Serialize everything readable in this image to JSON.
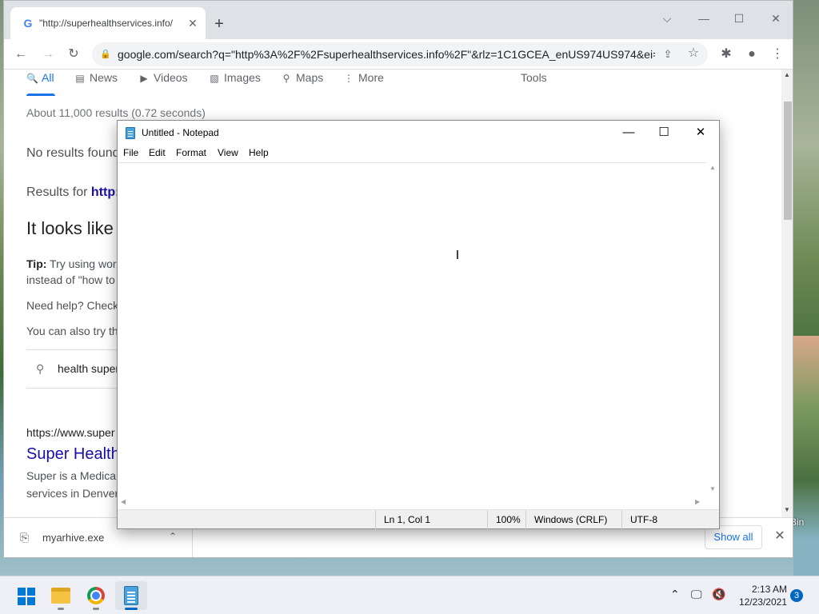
{
  "desktop": {
    "recycle_bin_partial": "Bin"
  },
  "chrome": {
    "tab": {
      "favicon": "G",
      "title": "\"http://superhealthservices.info/",
      "close": "✕"
    },
    "new_tab": "+",
    "window_controls": {
      "dropdown": "⌵",
      "minimize": "—",
      "maximize": "☐",
      "close": "✕"
    },
    "nav": {
      "back": "←",
      "forward": "→",
      "reload": "↻"
    },
    "omnibox": {
      "lock": "🔒",
      "url": "google.com/search?q=\"http%3A%2F%2Fsuperhealthservices.info%2F\"&rlz=1C1GCEA_enUS974US974&ei=...",
      "share": "⇪",
      "star": "☆"
    },
    "extensions": "✱",
    "profile": "●",
    "menu": "⋮"
  },
  "google": {
    "tabs": [
      {
        "label": "All",
        "icon": "search-icon",
        "glyph": "🔍"
      },
      {
        "label": "News",
        "icon": "news-icon",
        "glyph": "▤"
      },
      {
        "label": "Videos",
        "icon": "video-icon",
        "glyph": "▶"
      },
      {
        "label": "Images",
        "icon": "image-icon",
        "glyph": "▧"
      },
      {
        "label": "Maps",
        "icon": "map-pin-icon",
        "glyph": "⚲"
      },
      {
        "label": "More",
        "icon": "more-icon",
        "glyph": "⋮"
      }
    ],
    "tools": "Tools",
    "result_stats": "About 11,000 results (0.72 seconds)",
    "no_results": "No results found",
    "results_for_prefix": "Results for ",
    "results_for_link": "http:",
    "heading": "It looks like",
    "tip_label": "Tip:",
    "tip_text": " Try using word",
    "tip_line2": "instead of \"how to",
    "need_help": "Need help? Check",
    "also_try": "You can also try th",
    "suggestion": "health super",
    "result": {
      "url": "https://www.super",
      "title": "Super Health",
      "snippet1": "Super is a Medicar",
      "snippet2": "services in Denver"
    }
  },
  "downloads": {
    "file_name": "myarhive.exe",
    "show_all": "Show all",
    "close": "✕"
  },
  "notepad": {
    "title": "Untitled - Notepad",
    "controls": {
      "minimize": "—",
      "maximize": "☐",
      "close": "✕"
    },
    "menus": [
      "File",
      "Edit",
      "Format",
      "View",
      "Help"
    ],
    "content": "",
    "status": {
      "position": "Ln 1, Col 1",
      "zoom": "100%",
      "line_endings": "Windows (CRLF)",
      "encoding": "UTF-8"
    }
  },
  "taskbar": {
    "apps": [
      {
        "name": "start",
        "icon": "windows-start-icon"
      },
      {
        "name": "file-explorer",
        "icon": "folder-icon"
      },
      {
        "name": "chrome",
        "icon": "chrome-icon"
      },
      {
        "name": "notepad",
        "icon": "notepad-icon",
        "active": true
      }
    ],
    "tray": {
      "chevron": "⌃",
      "network": "🖵",
      "volume": "🔇"
    },
    "time": "2:13 AM",
    "date": "12/23/2021",
    "notifications": "3"
  }
}
